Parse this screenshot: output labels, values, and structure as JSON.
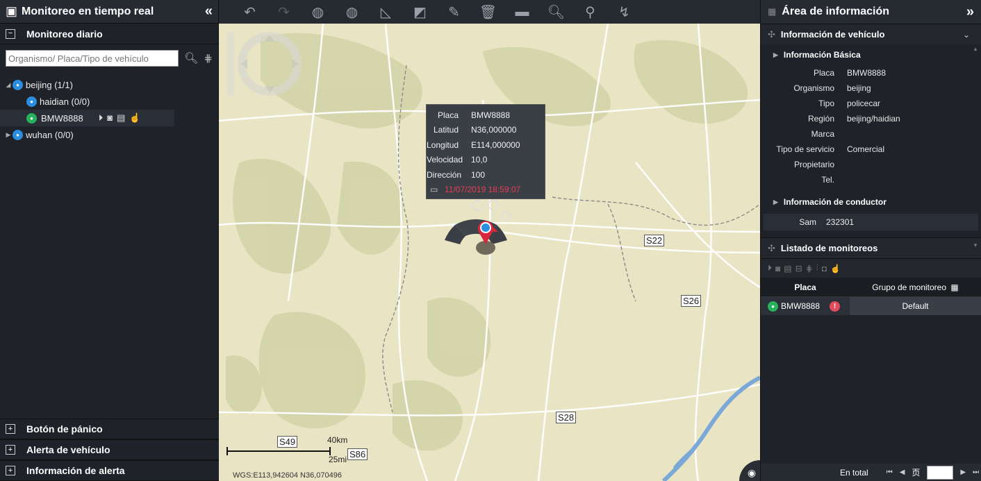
{
  "left": {
    "title": "Monitoreo en tiempo real",
    "daily_section": "Monitoreo diario",
    "search_placeholder": "Organismo/ Placa/Tipo de vehículo",
    "tree": {
      "root1": "beijing (1/1)",
      "child1": "haidian (0/0)",
      "vehicle": "BMW8888",
      "root2": "wuhan (0/0)"
    },
    "bottom_sections": [
      "Botón de pánico",
      "Alerta de vehículo",
      "Información de alerta"
    ]
  },
  "map": {
    "roads": [
      "S22",
      "S26",
      "S28",
      "S49",
      "S86"
    ],
    "scale_km": "40km",
    "scale_mi": "25mi",
    "coords": "WGS:E113,942604  N36,070496",
    "popup": {
      "rows": [
        {
          "k": "Placa",
          "v": "BMW8888"
        },
        {
          "k": "Latitud",
          "v": "N36,000000"
        },
        {
          "k": "Longitud",
          "v": "E114,000000"
        },
        {
          "k": "Velocidad",
          "v": "10,0"
        },
        {
          "k": "Dirección",
          "v": "100"
        }
      ],
      "time": "11/07/2019 18:59:07"
    }
  },
  "right": {
    "title": "Área de información",
    "vehicle_info": "Información de vehículo",
    "basic_info": "Información Básica",
    "fields": [
      {
        "k": "Placa",
        "v": "BMW8888"
      },
      {
        "k": "Organismo",
        "v": "beijing"
      },
      {
        "k": "Tipo",
        "v": "policecar"
      },
      {
        "k": "Región",
        "v": "beijing/haidian"
      },
      {
        "k": "Marca",
        "v": ""
      },
      {
        "k": "Tipo de servicio",
        "v": "Comercial"
      },
      {
        "k": "Propietario",
        "v": ""
      },
      {
        "k": "Tel.",
        "v": ""
      }
    ],
    "driver_info": "Información de conductor",
    "driver": {
      "k": "Sam",
      "v": "232301"
    },
    "monitor_list": "Listado de monitoreos",
    "table": {
      "col1": "Placa",
      "col2": "Grupo de monitoreo",
      "row": {
        "placa": "BMW8888",
        "grupo": "Default"
      }
    },
    "footer": {
      "total": "En total",
      "page_char": "页"
    }
  },
  "colors": {
    "accent": "#2b8ee0",
    "alert": "#e34b5a",
    "time": "#e83d55",
    "map": "#e9e4c4"
  }
}
